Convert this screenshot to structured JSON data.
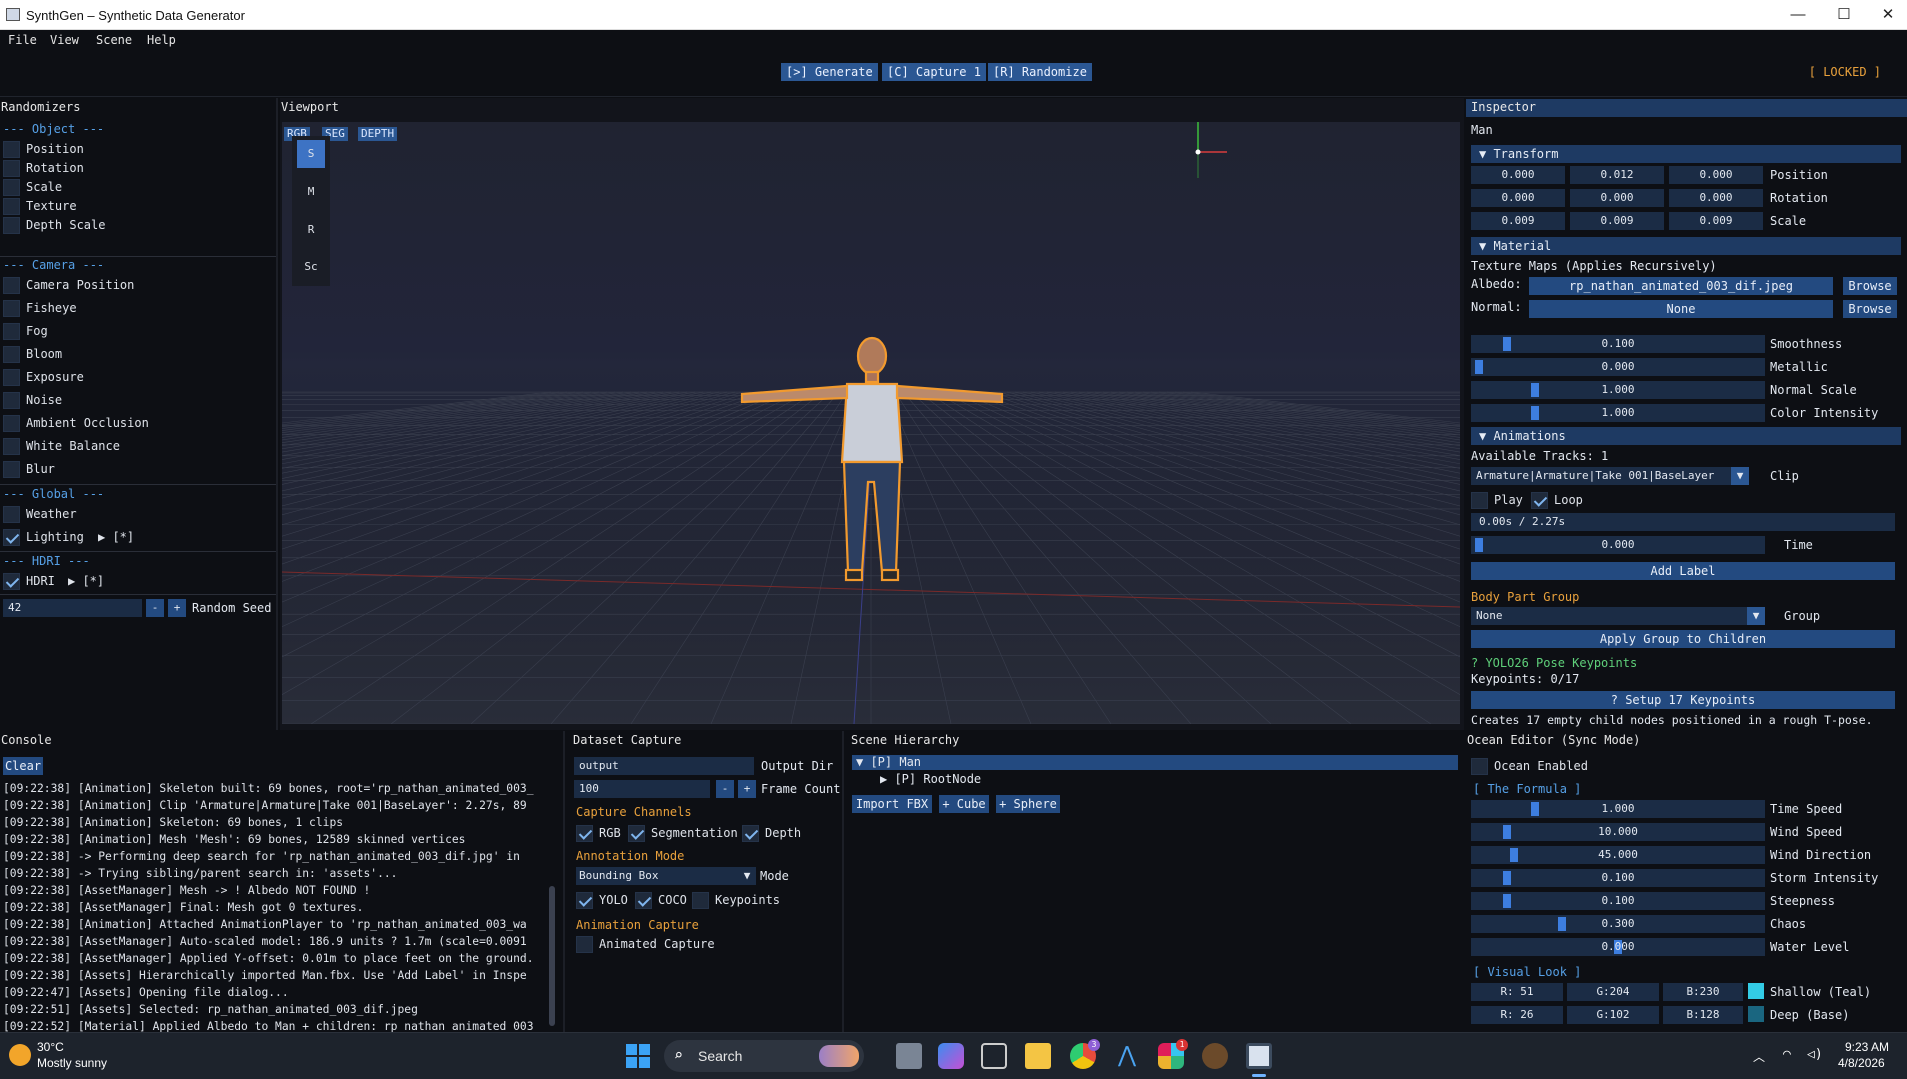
{
  "window": {
    "title": "SynthGen – Synthetic Data Generator",
    "minimize": "—",
    "maximize": "☐",
    "close": "✕"
  },
  "menu": [
    "File",
    "View",
    "Scene",
    "Help"
  ],
  "toolbar": {
    "generate": "[>] Generate",
    "capture": "[C] Capture 1",
    "randomize": "[R] Randomize",
    "locked": "[ LOCKED ]"
  },
  "randomizers": {
    "title": "Randomizers",
    "object_header": "--- Object ---",
    "object_items": [
      "Position",
      "Rotation",
      "Scale",
      "Texture",
      "Depth Scale"
    ],
    "camera_header": "--- Camera ---",
    "camera_items": [
      "Camera Position",
      "Fisheye",
      "Fog",
      "Bloom",
      "Exposure",
      "Noise",
      "Ambient Occlusion",
      "White Balance",
      "Blur"
    ],
    "global_header": "--- Global ---",
    "weather": "Weather",
    "lighting": "Lighting",
    "lighting_tree": "▶ [*]",
    "hdri_header": "--- HDRI ---",
    "hdri": "HDRI",
    "hdri_tree": "▶ [*]",
    "seed_value": "42",
    "seed_minus": "-",
    "seed_plus": "+",
    "seed_label": "Random Seed"
  },
  "viewport": {
    "title": "Viewport",
    "modes": [
      "RGB",
      "SEG",
      "DEPTH"
    ],
    "tools": [
      "S",
      "M",
      "R",
      "Sc"
    ]
  },
  "inspector": {
    "title": "Inspector",
    "object_name": "Man",
    "transform": {
      "header": "▼ Transform",
      "position": [
        "0.000",
        "0.012",
        "0.000"
      ],
      "position_label": "Position",
      "rotation": [
        "0.000",
        "0.000",
        "0.000"
      ],
      "rotation_label": "Rotation",
      "scale": [
        "0.009",
        "0.009",
        "0.009"
      ],
      "scale_label": "Scale"
    },
    "material": {
      "header": "▼ Material",
      "texture_maps": "Texture Maps (Applies Recursively)",
      "albedo_label": "Albedo:",
      "albedo_value": "rp_nathan_animated_003_dif.jpeg",
      "normal_label": "Normal:",
      "normal_value": "None",
      "browse": "Browse",
      "sliders": [
        {
          "value": "0.100",
          "label": "Smoothness",
          "fraction": 0.1
        },
        {
          "value": "0.000",
          "label": "Metallic",
          "fraction": 0.0
        },
        {
          "value": "1.000",
          "label": "Normal Scale",
          "fraction": 0.2
        },
        {
          "value": "1.000",
          "label": "Color Intensity",
          "fraction": 0.2
        }
      ]
    },
    "animations": {
      "header": "▼ Animations",
      "tracks": "Available Tracks: 1",
      "clip_value": "Armature|Armature|Take 001|BaseLayer",
      "clip_label": "Clip",
      "play": "Play",
      "loop": "Loop",
      "progress": "0.00s / 2.27s",
      "time_value": "0.000",
      "time_label": "Time",
      "add_label": "Add Label"
    },
    "body_part": {
      "header": "Body Part Group",
      "group_value": "None",
      "group_label": "Group",
      "apply": "Apply Group to Children"
    },
    "keypoints": {
      "header": "? YOLO26 Pose Keypoints",
      "count": "Keypoints: 0/17",
      "setup": "? Setup 17 Keypoints",
      "note": "Creates 17 empty child nodes positioned in a rough T-pose."
    }
  },
  "console": {
    "title": "Console",
    "clear": "Clear",
    "lines": [
      "[09:22:38] [Animation] Skeleton built: 69 bones, root='rp_nathan_animated_003_",
      "[09:22:38] [Animation] Clip 'Armature|Armature|Take 001|BaseLayer': 2.27s, 89",
      "[09:22:38] [Animation] Skeleton: 69 bones, 1 clips",
      "[09:22:38] [Animation] Mesh 'Mesh': 69 bones, 12589 skinned vertices",
      "[09:22:38]   -> Performing deep search for 'rp_nathan_animated_003_dif.jpg' in",
      "[09:22:38]   -> Trying sibling/parent search in: 'assets'...",
      "[09:22:38] [AssetManager] Mesh -> ! Albedo NOT FOUND !",
      "[09:22:38] [AssetManager] Final: Mesh got 0 textures.",
      "[09:22:38] [Animation] Attached AnimationPlayer to 'rp_nathan_animated_003_wa",
      "[09:22:38] [AssetManager] Auto-scaled model: 186.9 units ? 1.7m (scale=0.0091",
      "[09:22:38] [AssetManager] Applied Y-offset: 0.01m to place feet on the ground.",
      "[09:22:38] [Assets] Hierarchically imported Man.fbx. Use 'Add Label' in Inspe",
      "[09:22:47] [Assets] Opening file dialog...",
      "[09:22:51] [Assets] Selected: rp_nathan_animated_003_dif.jpeg",
      "[09:22:52] [Material] Applied Albedo to Man + children: rp_nathan_animated_003"
    ]
  },
  "dataset": {
    "title": "Dataset Capture",
    "output_value": "output",
    "output_label": "Output Dir",
    "frame_value": "100",
    "frame_minus": "-",
    "frame_plus": "+",
    "frame_label": "Frame Count",
    "channels_header": "Capture Channels",
    "channels": [
      "RGB",
      "Segmentation",
      "Depth"
    ],
    "annotation_header": "Annotation Mode",
    "mode_value": "Bounding Box",
    "mode_label": "Mode",
    "formats": [
      "YOLO",
      "COCO",
      "Keypoints"
    ],
    "anim_header": "Animation Capture",
    "anim_capture": "Animated Capture"
  },
  "hierarchy": {
    "title": "Scene Hierarchy",
    "root": "▼ [P] Man",
    "child": "▶ [P] RootNode",
    "import": "Import FBX",
    "cube": "+ Cube",
    "sphere": "+ Sphere"
  },
  "ocean": {
    "title": "Ocean Editor (Sync Mode)",
    "enabled": "Ocean Enabled",
    "formula_header": "[ The Formula ]",
    "sliders": [
      {
        "value": "1.000",
        "label": "Time Speed",
        "fraction": 0.2
      },
      {
        "value": "10.000",
        "label": "Wind Speed",
        "fraction": 0.1
      },
      {
        "value": "45.000",
        "label": "Wind Direction",
        "fraction": 0.125
      },
      {
        "value": "0.100",
        "label": "Storm Intensity",
        "fraction": 0.1
      },
      {
        "value": "0.100",
        "label": "Steepness",
        "fraction": 0.1
      },
      {
        "value": "0.300",
        "label": "Chaos",
        "fraction": 0.3
      },
      {
        "value": "0.000",
        "label": "Water Level",
        "fraction": 0.5
      }
    ],
    "visual_header": "[ Visual Look ]",
    "shallow": {
      "r": "R: 51",
      "g": "G:204",
      "b": "B:230",
      "label": "Shallow (Teal)",
      "color": "#33cce6"
    },
    "deep": {
      "r": "R: 26",
      "g": "G:102",
      "b": "B:128",
      "label": "Deep (Base)",
      "color": "#1a6680"
    }
  },
  "taskbar": {
    "temp": "30°C",
    "weather": "Mostly sunny",
    "search": "Search",
    "time": "9:23 AM",
    "date": "4/8/2026",
    "chrome_badge": "3",
    "slack_badge": "1"
  }
}
